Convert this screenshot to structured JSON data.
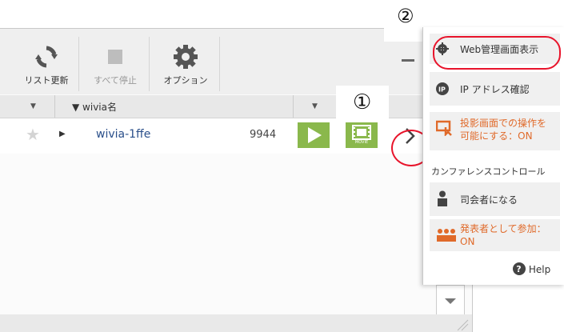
{
  "toolbar": {
    "refresh_label": "リスト更新",
    "stop_all_label": "すべて停止",
    "options_label": "オプション"
  },
  "table": {
    "name_header": "▼ wivia名",
    "rows": [
      {
        "name": "wivia-1ffe",
        "number": "9944",
        "movie_label": "MOVIE"
      }
    ]
  },
  "callouts": {
    "one": "①",
    "two": "②"
  },
  "menu": {
    "web_admin": "Web管理画面表示",
    "ip_check": "IP アドレス確認",
    "projection_control_line1": "投影画面での操作を",
    "projection_control_line2": "可能にする：ON",
    "conference_section": "カンファレンスコントロール",
    "become_moderator": "司会者になる",
    "join_presenter_line1": "発表者として参加：",
    "join_presenter_line2": "ON",
    "help": "Help"
  },
  "colors": {
    "accent_green": "#8ab84c",
    "highlight_red": "#e8142b",
    "orange_text": "#e06a2a",
    "link_blue": "#2a4f8a"
  }
}
